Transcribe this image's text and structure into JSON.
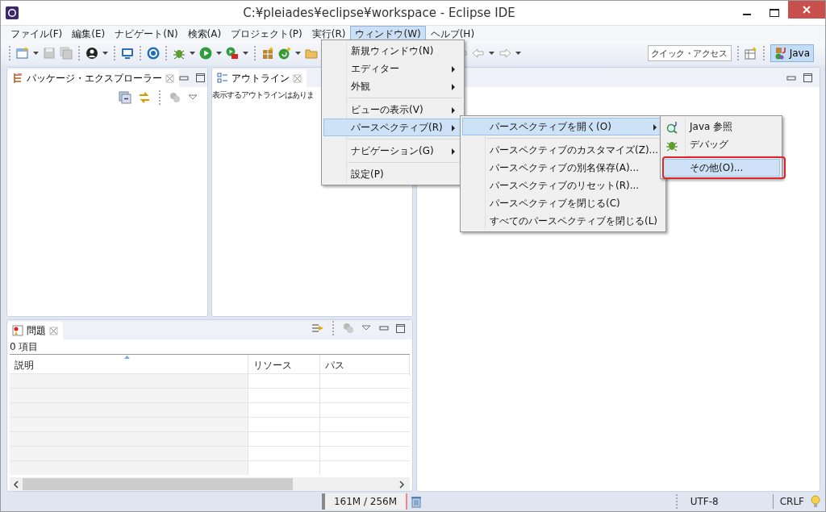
{
  "window": {
    "title": "C:¥pleiades¥eclipse¥workspace - Eclipse IDE"
  },
  "menu_bar": [
    {
      "label": "ファイル(F)",
      "selected": false
    },
    {
      "label": "編集(E)",
      "selected": false
    },
    {
      "label": "ナビゲート(N)",
      "selected": false
    },
    {
      "label": "検索(A)",
      "selected": false
    },
    {
      "label": "プロジェクト(P)",
      "selected": false
    },
    {
      "label": "実行(R)",
      "selected": false
    },
    {
      "label": "ウィンドウ(W)",
      "selected": true
    },
    {
      "label": "ヘルプ(H)",
      "selected": false
    }
  ],
  "toolbar": {
    "quick_access": {
      "placeholder": "クイック・アクセス"
    },
    "perspectives": [
      {
        "label": "Java",
        "selected": true
      }
    ]
  },
  "package_explorer": {
    "tab": "パッケージ・エクスプローラー"
  },
  "outline": {
    "tab": "アウトライン",
    "message": "表示するアウトラインはありま"
  },
  "problems": {
    "tab": "問題",
    "count": "0 項目",
    "columns": [
      "説明",
      "リソース",
      "パス"
    ]
  },
  "window_menu": [
    {
      "kind": "item",
      "label": "新規ウィンドウ(N)",
      "submenu": false,
      "selected": false
    },
    {
      "kind": "item",
      "label": "エディター",
      "submenu": true,
      "selected": false
    },
    {
      "kind": "item",
      "label": "外観",
      "submenu": true,
      "selected": false
    },
    {
      "kind": "separator"
    },
    {
      "kind": "item",
      "label": "ビューの表示(V)",
      "submenu": true,
      "selected": false
    },
    {
      "kind": "item",
      "label": "パースペクティブ(R)",
      "submenu": true,
      "selected": true
    },
    {
      "kind": "separator"
    },
    {
      "kind": "item",
      "label": "ナビゲーション(G)",
      "submenu": true,
      "selected": false
    },
    {
      "kind": "separator"
    },
    {
      "kind": "item",
      "label": "設定(P)",
      "submenu": false,
      "selected": false
    }
  ],
  "perspective_menu": [
    {
      "kind": "item",
      "label": "パースペクティブを開く(O)",
      "submenu": true,
      "selected": true
    },
    {
      "kind": "separator"
    },
    {
      "kind": "item",
      "label": "パースペクティブのカスタマイズ(Z)...",
      "submenu": false,
      "selected": false
    },
    {
      "kind": "item",
      "label": "パースペクティブの別名保存(A)...",
      "submenu": false,
      "selected": false
    },
    {
      "kind": "item",
      "label": "パースペクティブのリセット(R)...",
      "submenu": false,
      "selected": false
    },
    {
      "kind": "item",
      "label": "パースペクティブを閉じる(C)",
      "submenu": false,
      "selected": false
    },
    {
      "kind": "item",
      "label": "すべてのパースペクティブを閉じる(L)",
      "submenu": false,
      "selected": false
    }
  ],
  "open_perspective_menu": [
    {
      "kind": "item",
      "label": "Java 参照",
      "submenu": false,
      "selected": false,
      "highlighted": false
    },
    {
      "kind": "item",
      "label": "デバッグ",
      "submenu": false,
      "selected": false,
      "highlighted": false
    },
    {
      "kind": "separator"
    },
    {
      "kind": "item",
      "label": "その他(O)...",
      "submenu": false,
      "selected": true,
      "highlighted": true
    }
  ],
  "status_bar": {
    "heap": "161M / 256M",
    "encoding": "UTF-8",
    "line_delimiter": "CRLF"
  }
}
